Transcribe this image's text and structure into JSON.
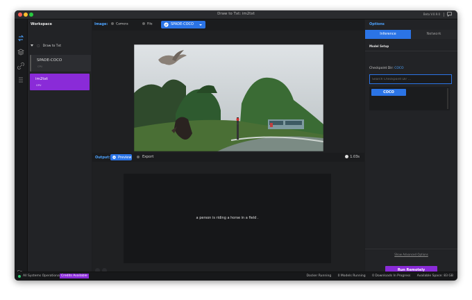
{
  "window": {
    "title": "Draw to Txt: im2txt",
    "version": "Beta V.0.9.0"
  },
  "sidebar": {
    "heading": "Workspace",
    "group": "Draw to Txt",
    "items": [
      {
        "name": "SPADE-COCO",
        "sub": "CPU"
      },
      {
        "name": "im2txt",
        "sub": "GPU"
      }
    ],
    "bottom_label": "Go"
  },
  "toolbar": {
    "image_label": "Image:",
    "camera_label": "Camera",
    "file_label": "File",
    "selected_model": "SPADE-COCO"
  },
  "output": {
    "label": "Output:",
    "preview_label": "Preview",
    "export_label": "Export",
    "time": "1.03s",
    "text": "a person is riding a horse in a field ."
  },
  "options": {
    "heading": "Options",
    "tabs": [
      "Inference",
      "Network"
    ],
    "section": "Model Setup",
    "checkpoint_label": "Checkpoint Dir:",
    "checkpoint_value": "COCO",
    "search_placeholder": "Search Checkpoint Dir ...",
    "list_items": [
      "COCO"
    ],
    "show_advanced": "Show Advanced Options",
    "run_label": "Run Remotely"
  },
  "status": {
    "system": "All Systems Operational",
    "credits": "Credits Available",
    "docker": "Docker Running",
    "models": "0 Models Running",
    "downloads": "0 Downloads In Progress",
    "space": "Available Space: 83 GB"
  },
  "colors": {
    "accent": "#2b74e6",
    "purple": "#8a2bd8",
    "success": "#2ecc71"
  }
}
